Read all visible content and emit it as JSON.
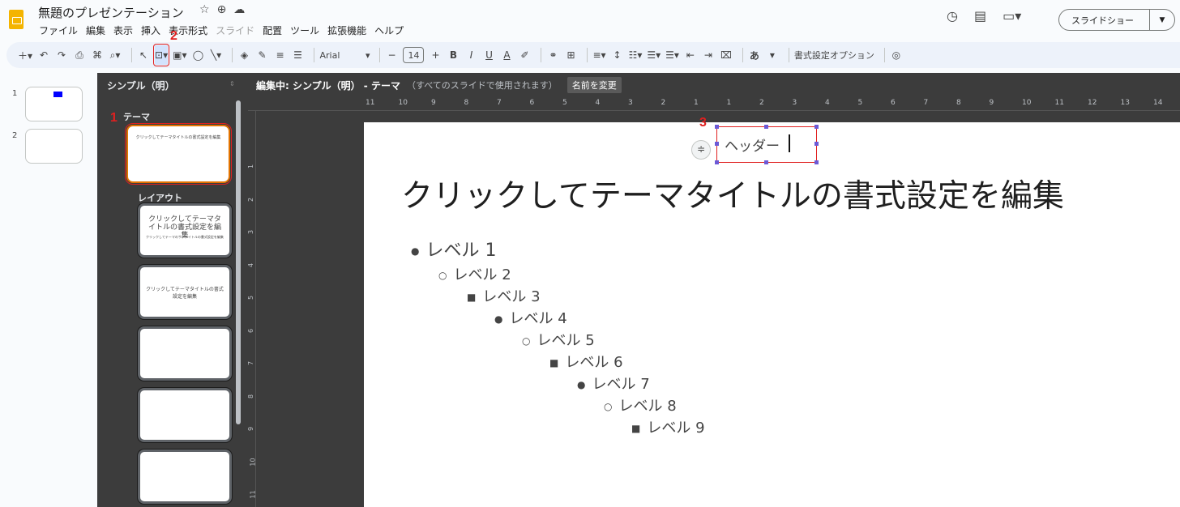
{
  "app": {
    "title": "無題のプレゼンテーション"
  },
  "menu": [
    "ファイル",
    "編集",
    "表示",
    "挿入",
    "表示形式",
    "スライド",
    "配置",
    "ツール",
    "拡張機能",
    "ヘルプ"
  ],
  "topright": {
    "slideshow_label": "スライドショー"
  },
  "toolbar": {
    "font": "Arial",
    "size": "14",
    "format_options": "書式設定オプション",
    "bold": "B",
    "italic": "I",
    "underline": "U",
    "text_color": "A",
    "input_tool": "あ"
  },
  "steps": [
    "1",
    "2",
    "3"
  ],
  "thumbs": {
    "n1": "1",
    "n2": "2"
  },
  "theme_panel": {
    "title": "シンプル（明）",
    "theme_label": "テーマ",
    "layout_label": "レイアウト",
    "master_title": "クリックしてテーマタイトルの書式設定を編集",
    "layout1_title": "クリックしてテーマタイトルの書式設定を編集",
    "layout1_sub": "クリックしてテーマのサブタイトルの書式設定を編集",
    "layout2_title": "クリックしてテーマタイトルの書式設定を編集"
  },
  "editbar": {
    "label": "編集中: シンプル（明） - テーマ",
    "sub": "（すべてのスライドで使用されます）",
    "rename": "名前を変更"
  },
  "ruler": [
    "11",
    "10",
    "9",
    "8",
    "7",
    "6",
    "5",
    "4",
    "3",
    "2",
    "1",
    "1",
    "2",
    "3",
    "4",
    "5",
    "6",
    "7",
    "8",
    "9",
    "10",
    "11",
    "12",
    "13",
    "14"
  ],
  "ruler_v": [
    "1",
    "2",
    "3",
    "4",
    "5",
    "6",
    "7",
    "8",
    "9",
    "10",
    "11"
  ],
  "slide": {
    "header": "ヘッダー",
    "title": "クリックしてテーマタイトルの書式設定を編集",
    "levels": [
      "レベル 1",
      "レベル 2",
      "レベル 3",
      "レベル 4",
      "レベル 5",
      "レベル 6",
      "レベル 7",
      "レベル 8",
      "レベル 9"
    ]
  },
  "colors": {
    "accent": "#e02020",
    "master_border": "#e37400",
    "panel": "#3c3c3c"
  }
}
